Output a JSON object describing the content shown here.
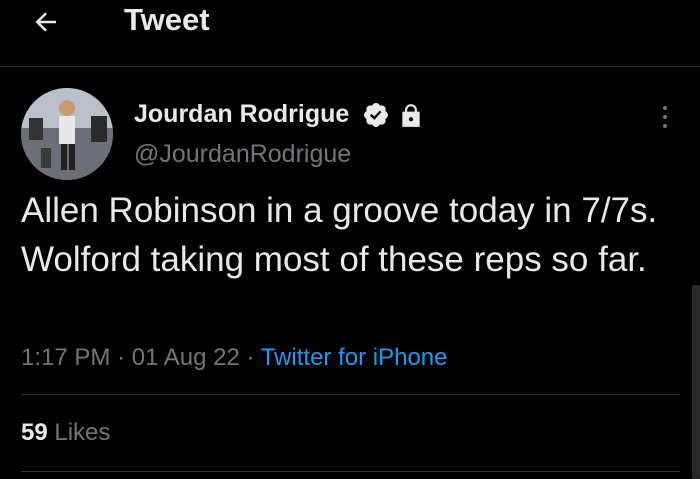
{
  "header": {
    "title": "Tweet",
    "back_icon": "arrow-left-icon"
  },
  "tweet": {
    "author": {
      "display_name": "Jourdan Rodrigue",
      "handle": "@JourdanRodrigue",
      "verified": true,
      "protected": true
    },
    "text": "Allen Robinson in a groove today in 7/7s. Wolford taking most of these reps so far.",
    "time": "1:17 PM",
    "date": "01 Aug 22",
    "separator": "·",
    "source": "Twitter for iPhone",
    "likes_count": "59",
    "likes_label": "Likes"
  },
  "colors": {
    "background": "#000000",
    "text_primary": "#e7e9ea",
    "text_secondary": "#71767b",
    "accent": "#1d9bf0",
    "divider": "#2f3336"
  }
}
